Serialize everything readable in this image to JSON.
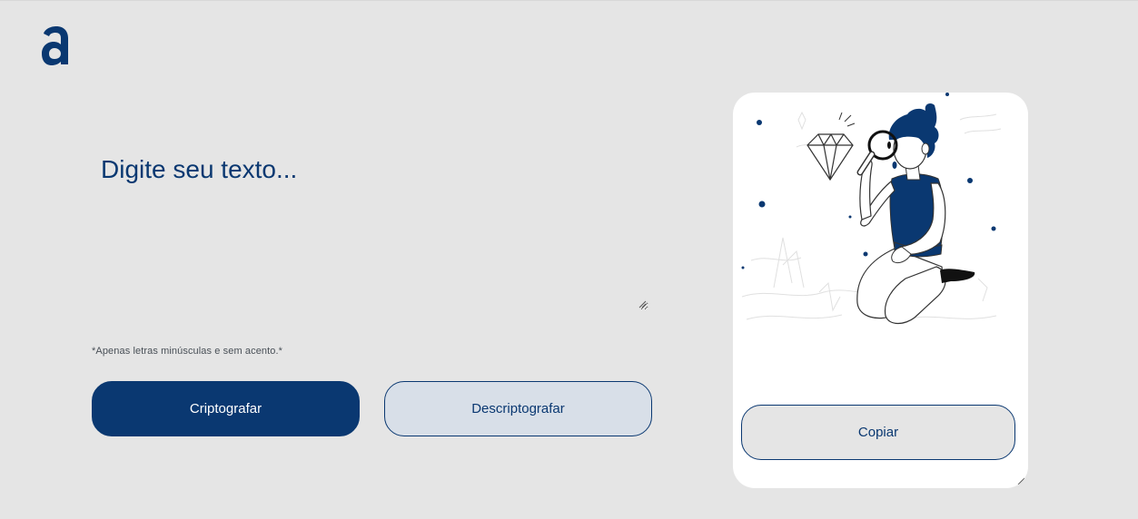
{
  "logo": {
    "icon": "alura-logo-icon",
    "color": "#0a3871"
  },
  "input": {
    "placeholder": "Digite seu texto..."
  },
  "hint": {
    "text": "*Apenas letras minúsculas e sem acento.*"
  },
  "buttons": {
    "encrypt_label": "Criptografar",
    "decrypt_label": "Descriptografar",
    "copy_label": "Copiar"
  },
  "colors": {
    "accent": "#0a3871",
    "background": "#e5e5e5",
    "secondary_button": "#d8dfe8",
    "panel": "#ffffff"
  },
  "output": {
    "illustration_icon": "boy-with-magnifier-illustration"
  }
}
